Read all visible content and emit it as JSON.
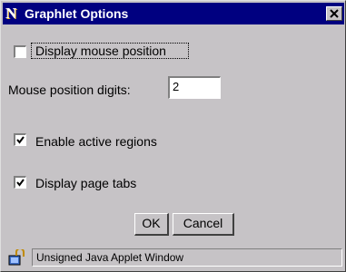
{
  "window": {
    "title": "Graphlet Options",
    "app_icon": "n-logo-icon",
    "close_icon": "close-icon"
  },
  "options": {
    "display_mouse_position": {
      "label": "Display mouse position",
      "checked": false
    },
    "mouse_position_digits": {
      "label": "Mouse position digits:",
      "value": "2"
    },
    "enable_active_regions": {
      "label": "Enable active regions",
      "checked": true
    },
    "display_page_tabs": {
      "label": "Display page tabs",
      "checked": true
    }
  },
  "buttons": {
    "ok": "OK",
    "cancel": "Cancel"
  },
  "status": {
    "icon": "java-applet-icon",
    "text": "Unsigned Java Applet Window"
  },
  "colors": {
    "titlebar": "#000080",
    "dialog": "#c6c3c6"
  }
}
